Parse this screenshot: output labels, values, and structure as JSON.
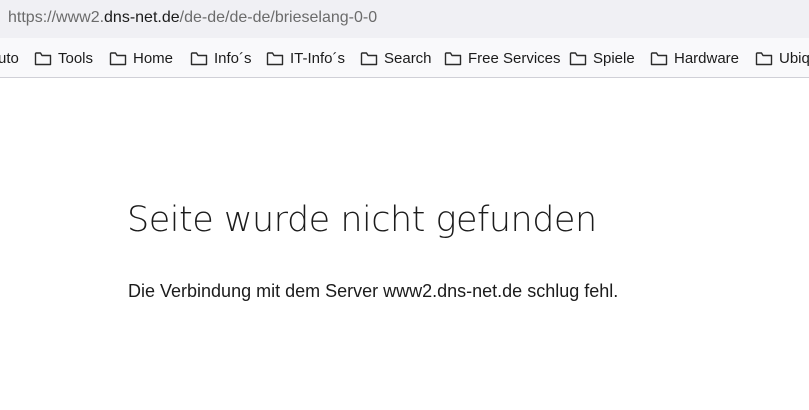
{
  "address_bar": {
    "prefix": "https://www2.",
    "host": "dns-net.de",
    "path": "/de-de/de-de/brieselang-0-0"
  },
  "bookmarks": [
    {
      "label": "uto",
      "icon": "folder-icon"
    },
    {
      "label": "Tools",
      "icon": "folder-icon"
    },
    {
      "label": "Home",
      "icon": "folder-icon"
    },
    {
      "label": "Info´s",
      "icon": "folder-icon"
    },
    {
      "label": "IT-Info´s",
      "icon": "folder-icon"
    },
    {
      "label": "Search",
      "icon": "folder-icon"
    },
    {
      "label": "Free Services",
      "icon": "folder-icon"
    },
    {
      "label": "Spiele",
      "icon": "folder-icon"
    },
    {
      "label": "Hardware",
      "icon": "folder-icon"
    },
    {
      "label": "Ubiq",
      "icon": "folder-icon"
    }
  ],
  "error_page": {
    "title": "Seite wurde nicht gefunden",
    "description": "Die Verbindung mit dem Server www2.dns-net.de schlug fehl."
  }
}
